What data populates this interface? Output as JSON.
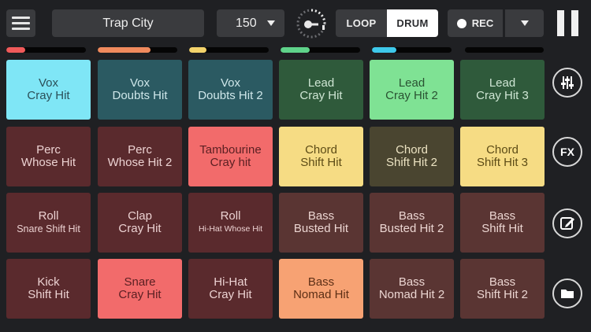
{
  "header": {
    "kit_title": "Trap City",
    "bpm": "150",
    "mode_loop": "LOOP",
    "mode_drum": "DRUM",
    "active_mode": "DRUM",
    "rec_label": "REC"
  },
  "icons": {
    "menu": "hamburger-menu-icon",
    "tempo_knob": "tempo-knob-icon",
    "bpm_dropdown": "chevron-down-icon",
    "rec_dot": "record-dot-icon",
    "rec_dropdown": "chevron-down-icon",
    "pause": "pause-icon",
    "mixer": "sliders-icon",
    "fx": "fx-icon",
    "edit": "edit-pencil-icon",
    "folder": "folder-icon"
  },
  "meters": [
    {
      "level": 0.24,
      "color": "#f05a5a"
    },
    {
      "level": 0.66,
      "color": "#f08a5d"
    },
    {
      "level": 0.22,
      "color": "#f3d36b"
    },
    {
      "level": 0.37,
      "color": "#5fd38a"
    },
    {
      "level": 0.31,
      "color": "#3ec9ea"
    },
    {
      "level": 0.0,
      "color": "#2b2c2f"
    }
  ],
  "side": {
    "fx_label": "FX"
  },
  "pads": [
    {
      "line1": "Vox",
      "line2": "Cray Hit",
      "bg": "#7fe6f6",
      "fg": "#2b4f58",
      "active": true
    },
    {
      "line1": "Vox",
      "line2": "Doubts Hit",
      "bg": "#2b5a62",
      "fg": "#cfe7ea"
    },
    {
      "line1": "Vox",
      "line2": "Doubts Hit 2",
      "bg": "#2b5a62",
      "fg": "#cfe7ea"
    },
    {
      "line1": "Lead",
      "line2": "Cray Hit",
      "bg": "#2f5a3b",
      "fg": "#cfe6d4"
    },
    {
      "line1": "Lead",
      "line2": "Cray Hit 2",
      "bg": "#7fe294",
      "fg": "#2a5232",
      "active": true
    },
    {
      "line1": "Lead",
      "line2": "Cray Hit 3",
      "bg": "#2f5a3b",
      "fg": "#cfe6d4"
    },
    {
      "line1": "Perc",
      "line2": "Whose Hit",
      "bg": "#5a2a2d",
      "fg": "#ecd2d2"
    },
    {
      "line1": "Perc",
      "line2": "Whose Hit 2",
      "bg": "#5a2a2d",
      "fg": "#ecd2d2"
    },
    {
      "line1": "Tambourine",
      "line2": "Cray hit",
      "bg": "#f26b6b",
      "fg": "#5a1f22",
      "active": true
    },
    {
      "line1": "Chord",
      "line2": "Shift Hit",
      "bg": "#f6dc84",
      "fg": "#5d4c16",
      "active": true
    },
    {
      "line1": "Chord",
      "line2": "Shift Hit 2",
      "bg": "#4a4530",
      "fg": "#ece3c2"
    },
    {
      "line1": "Chord",
      "line2": "Shift Hit 3",
      "bg": "#f6dc84",
      "fg": "#5d4c16",
      "active": true
    },
    {
      "line1": "Roll",
      "line2": "Snare Shift Hit",
      "bg": "#5a2a2d",
      "fg": "#ecd2d2",
      "small": true
    },
    {
      "line1": "Clap",
      "line2": "Cray Hit",
      "bg": "#5a2a2d",
      "fg": "#ecd2d2"
    },
    {
      "line1": "Roll",
      "line2": "Hi-Hat Whose Hit",
      "bg": "#5a2a2d",
      "fg": "#ecd2d2",
      "small": true,
      "tiny": true
    },
    {
      "line1": "Bass",
      "line2": "Busted Hit",
      "bg": "#5a3533",
      "fg": "#ecd6d2"
    },
    {
      "line1": "Bass",
      "line2": "Busted Hit 2",
      "bg": "#5a3533",
      "fg": "#ecd6d2"
    },
    {
      "line1": "Bass",
      "line2": "Shift Hit",
      "bg": "#5a3533",
      "fg": "#ecd6d2"
    },
    {
      "line1": "Kick",
      "line2": "Shift Hit",
      "bg": "#5a2a2d",
      "fg": "#ecd2d2"
    },
    {
      "line1": "Snare",
      "line2": "Cray Hit",
      "bg": "#f26b6b",
      "fg": "#5a1f22",
      "active": true
    },
    {
      "line1": "Hi-Hat",
      "line2": "Cray Hit",
      "bg": "#5a2a2d",
      "fg": "#ecd2d2"
    },
    {
      "line1": "Bass",
      "line2": "Nomad Hit",
      "bg": "#f7a273",
      "fg": "#5d2f16",
      "active": true
    },
    {
      "line1": "Bass",
      "line2": "Nomad Hit 2",
      "bg": "#5a3533",
      "fg": "#ecd6d2"
    },
    {
      "line1": "Bass",
      "line2": "Shift Hit 2",
      "bg": "#5a3533",
      "fg": "#ecd6d2"
    }
  ]
}
